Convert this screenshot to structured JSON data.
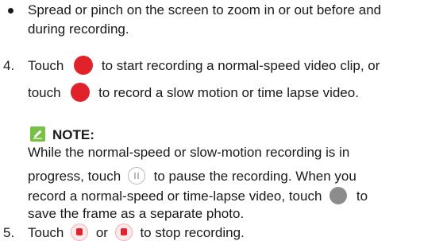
{
  "colors": {
    "record_red": "#e2222a",
    "note_green": "#78c043",
    "shutter_gray": "#8c8c8c"
  },
  "bullet": {
    "line1": "Spread or pinch on the screen to zoom in or out before and",
    "line2": "during recording."
  },
  "step4": {
    "number": "4.",
    "line1_a": "Touch",
    "line1_b": "to start recording a normal-speed video clip, or",
    "line2_a": "touch",
    "line2_b": "to record a slow motion or time lapse video."
  },
  "note": {
    "label": "NOTE:",
    "line1": "While the normal-speed or slow-motion recording is in",
    "line2_a": "progress, touch",
    "line2_b": "to pause the recording. When you",
    "line3_a": "record a normal-speed or time-lapse video, touch",
    "line3_b": "to",
    "line4": "save the frame as a separate photo."
  },
  "step5": {
    "number": "5.",
    "a": "Touch",
    "b": "or",
    "c": "to stop recording."
  },
  "icons": [
    "record-icon",
    "slow-motion-record-icon",
    "pause-icon",
    "snapshot-icon",
    "stop-icon",
    "note-icon"
  ]
}
